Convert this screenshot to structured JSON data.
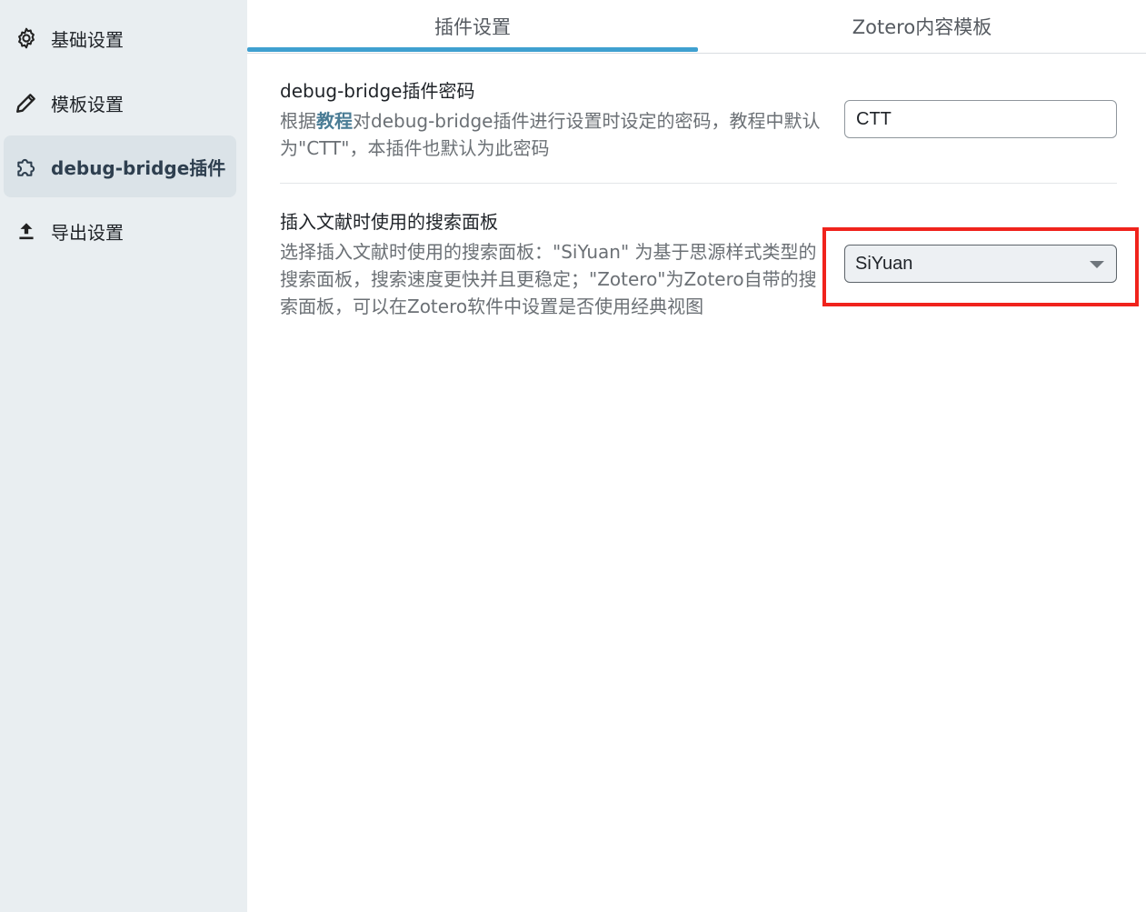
{
  "sidebar": {
    "items": [
      {
        "label": "基础设置",
        "icon": "gear-icon",
        "active": false
      },
      {
        "label": "模板设置",
        "icon": "pencil-icon",
        "active": false
      },
      {
        "label": "debug-bridge插件",
        "icon": "puzzle-icon",
        "active": true
      },
      {
        "label": "导出设置",
        "icon": "upload-icon",
        "active": false
      }
    ]
  },
  "tabs": [
    {
      "label": "插件设置",
      "active": true
    },
    {
      "label": "Zotero内容模板",
      "active": false
    }
  ],
  "settings": {
    "password": {
      "title": "debug-bridge插件密码",
      "desc_prefix": "根据",
      "desc_link": "教程",
      "desc_suffix": "对debug-bridge插件进行设置时设定的密码，教程中默认为\"CTT\"，本插件也默认为此密码",
      "value": "CTT"
    },
    "search_panel": {
      "title": "插入文献时使用的搜索面板",
      "desc": "选择插入文献时使用的搜索面板：\"SiYuan\" 为基于思源样式类型的搜索面板，搜索速度更快并且更稳定；\"Zotero\"为Zotero自带的搜索面板，可以在Zotero软件中设置是否使用经典视图",
      "selected": "SiYuan"
    }
  },
  "colors": {
    "sidebar_bg": "#e9eef1",
    "sidebar_active_bg": "#dbe3e8",
    "tab_accent": "#3fa0d0",
    "link": "#4a7c95",
    "highlight": "#f0231c"
  }
}
